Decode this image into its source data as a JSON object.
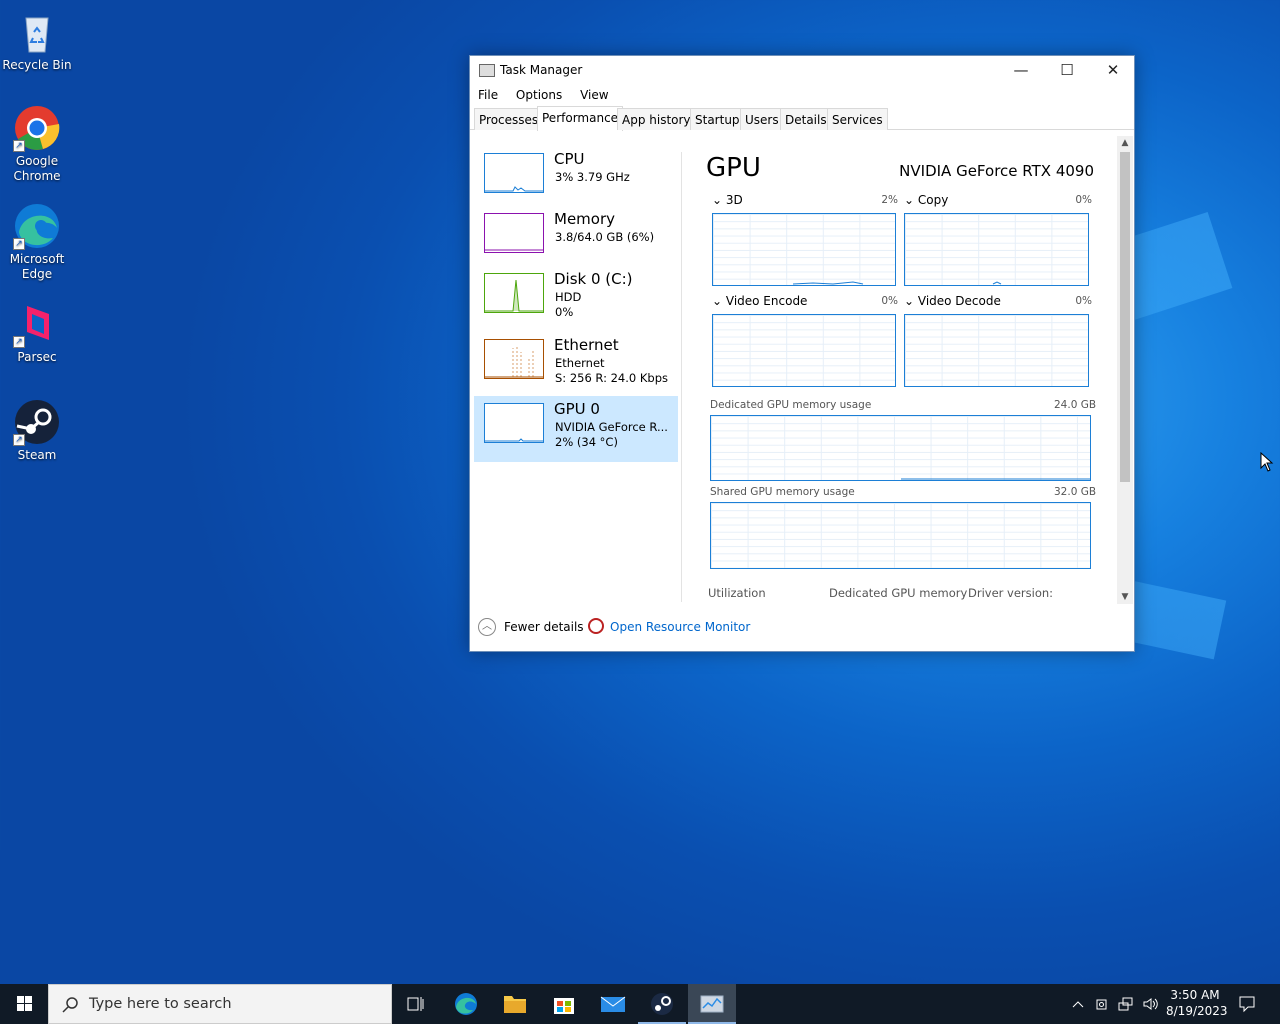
{
  "desktop": {
    "icons": [
      {
        "label": "Recycle Bin"
      },
      {
        "label": "Google Chrome"
      },
      {
        "label": "Microsoft Edge"
      },
      {
        "label": "Parsec"
      },
      {
        "label": "Steam"
      }
    ]
  },
  "window": {
    "title": "Task Manager",
    "menu": [
      "File",
      "Options",
      "View"
    ],
    "tabs": [
      "Processes",
      "Performance",
      "App history",
      "Startup",
      "Users",
      "Details",
      "Services"
    ],
    "active_tab": "Performance",
    "sidebar": [
      {
        "name": "CPU",
        "line1": "3% 3.79 GHz",
        "line2": "",
        "color": "#1c7fd6"
      },
      {
        "name": "Memory",
        "line1": "3.8/64.0 GB (6%)",
        "line2": "",
        "color": "#8b12ae"
      },
      {
        "name": "Disk 0 (C:)",
        "line1": "HDD",
        "line2": "0%",
        "color": "#4da60c"
      },
      {
        "name": "Ethernet",
        "line1": "Ethernet",
        "line2": "S: 256 R: 24.0 Kbps",
        "color": "#a74f01"
      },
      {
        "name": "GPU 0",
        "line1": "NVIDIA GeForce R...",
        "line2": "2% (34 °C)",
        "color": "#1c7fd6"
      }
    ],
    "main": {
      "title": "GPU",
      "gpu_name": "NVIDIA GeForce RTX 4090",
      "engines": [
        {
          "label": "3D",
          "pct": "2%"
        },
        {
          "label": "Copy",
          "pct": "0%"
        },
        {
          "label": "Video Encode",
          "pct": "0%"
        },
        {
          "label": "Video Decode",
          "pct": "0%"
        }
      ],
      "dedicated_label": "Dedicated GPU memory usage",
      "dedicated_max": "24.0 GB",
      "shared_label": "Shared GPU memory usage",
      "shared_max": "32.0 GB",
      "stats": [
        "Utilization",
        "Dedicated GPU memory",
        "Driver version:"
      ]
    },
    "footer": {
      "fewer": "Fewer details",
      "monitor": "Open Resource Monitor"
    }
  },
  "taskbar": {
    "search_placeholder": "Type here to search",
    "time": "3:50 AM",
    "date": "8/19/2023"
  }
}
